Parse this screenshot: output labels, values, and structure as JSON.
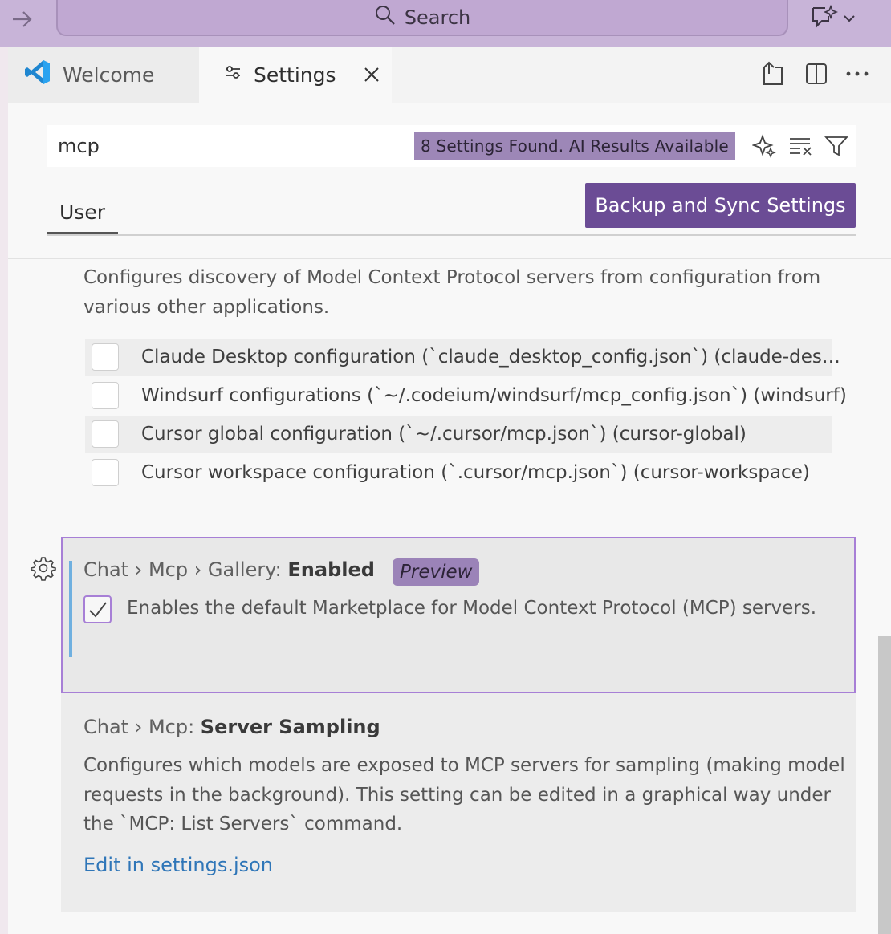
{
  "titlebar": {
    "search_placeholder": "Search",
    "back_icon": "arrow-right-icon",
    "chat_icon": "sparkle-chat-icon"
  },
  "tabs": [
    {
      "label": "Welcome",
      "icon": "vscode-logo-icon"
    },
    {
      "label": "Settings",
      "icon": "settings-sliders-icon",
      "active": true
    }
  ],
  "editor_actions": [
    "open-settings-json-icon",
    "split-editor-icon",
    "more-actions-icon"
  ],
  "search": {
    "value": "mcp",
    "result_badge": "8 Settings Found. AI Results Available",
    "tools": [
      "ai-sparkle-icon",
      "clear-filter-icon",
      "filter-icon"
    ]
  },
  "scope": {
    "tab_user": "User",
    "backup_button": "Backup and Sync Settings"
  },
  "discovery": {
    "description": "Configures discovery of Model Context Protocol servers from configuration from various other applications.",
    "options": [
      {
        "label": "Claude Desktop configuration (`claude_desktop_config.json`) (claude-des…",
        "checked": false
      },
      {
        "label": "Windsurf configurations (`~/.codeium/windsurf/mcp_config.json`) (windsurf)",
        "checked": false
      },
      {
        "label": "Cursor global configuration (`~/.cursor/mcp.json`) (cursor-global)",
        "checked": false
      },
      {
        "label": "Cursor workspace configuration (`.cursor/mcp.json`) (cursor-workspace)",
        "checked": false
      }
    ]
  },
  "gallery": {
    "title_prefix": "Chat › Mcp › Gallery: ",
    "title_name": "Enabled",
    "badge": "Preview",
    "checked": true,
    "description": "Enables the default Marketplace for Model Context Protocol (MCP) servers."
  },
  "sampling": {
    "title_prefix": "Chat › Mcp: ",
    "title_name": "Server Sampling",
    "description": "Configures which models are exposed to MCP servers for sampling (making model requests in the background). This setting can be edited in a graphical way under the `MCP: List Servers` command.",
    "link": "Edit in settings.json"
  },
  "colors": {
    "titlebar": "#c8b4d8",
    "accent": "#6b4c95",
    "focus_border": "#a77fd6",
    "link": "#2f76b8"
  }
}
